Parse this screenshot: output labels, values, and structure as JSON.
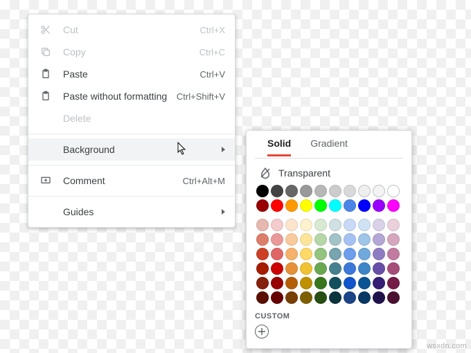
{
  "context_menu": {
    "cut": {
      "label": "Cut",
      "shortcut": "Ctrl+X"
    },
    "copy": {
      "label": "Copy",
      "shortcut": "Ctrl+C"
    },
    "paste": {
      "label": "Paste",
      "shortcut": "Ctrl+V"
    },
    "paste_wf": {
      "label": "Paste without formatting",
      "shortcut": "Ctrl+Shift+V"
    },
    "delete": {
      "label": "Delete"
    },
    "background": {
      "label": "Background"
    },
    "comment": {
      "label": "Comment",
      "shortcut": "Ctrl+Alt+M"
    },
    "guides": {
      "label": "Guides"
    }
  },
  "color_panel": {
    "tabs": {
      "solid": "Solid",
      "gradient": "Gradient"
    },
    "transparent_label": "Transparent",
    "custom_label": "CUSTOM",
    "row_top": [
      "#000000",
      "#434343",
      "#666666",
      "#999999",
      "#b7b7b7",
      "#cccccc",
      "#d9d9d9",
      "#efefef",
      "#f3f3f3",
      "#ffffff"
    ],
    "row_accent": [
      "#980000",
      "#ff0000",
      "#ff9900",
      "#ffff00",
      "#00ff00",
      "#00ffff",
      "#4a86e8",
      "#0000ff",
      "#9900ff",
      "#ff00ff"
    ],
    "grid": [
      [
        "#e6b8af",
        "#f4cccc",
        "#fce5cd",
        "#fff2cc",
        "#d9ead3",
        "#d0e0e3",
        "#c9daf8",
        "#cfe2f3",
        "#d9d2e9",
        "#ead1dc"
      ],
      [
        "#dd7e6b",
        "#ea9999",
        "#f9cb9c",
        "#ffe599",
        "#b6d7a8",
        "#a2c4c9",
        "#a4c2f4",
        "#9fc5e8",
        "#b4a7d6",
        "#d5a6bd"
      ],
      [
        "#cc4125",
        "#e06666",
        "#f6b26b",
        "#ffd966",
        "#93c47d",
        "#76a5af",
        "#6d9eeb",
        "#6fa8dc",
        "#8e7cc3",
        "#c27ba0"
      ],
      [
        "#a61c00",
        "#cc0000",
        "#e69138",
        "#f1c232",
        "#6aa84f",
        "#45818e",
        "#3c78d8",
        "#3d85c6",
        "#674ea7",
        "#a64d79"
      ],
      [
        "#85200c",
        "#990000",
        "#b45f06",
        "#bf9000",
        "#38761d",
        "#134f5c",
        "#1155cc",
        "#0b5394",
        "#351c75",
        "#741b47"
      ],
      [
        "#5b0f00",
        "#660000",
        "#783f04",
        "#7f6000",
        "#274e13",
        "#0c343d",
        "#1c4587",
        "#073763",
        "#20124d",
        "#4c1130"
      ]
    ]
  },
  "watermark": "wsxdn.com"
}
